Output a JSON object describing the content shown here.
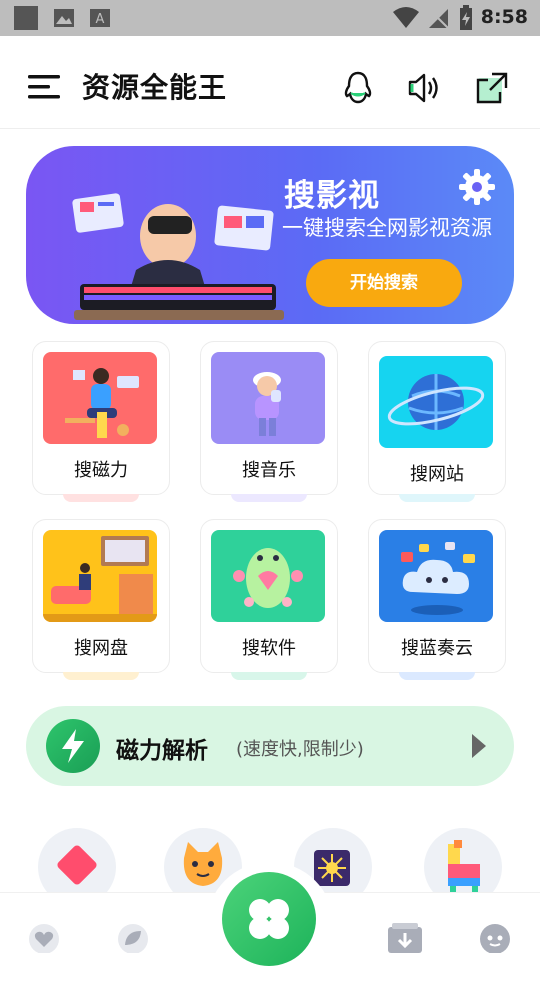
{
  "status_bar": {
    "time": "8:58"
  },
  "app": {
    "title": "资源全能王"
  },
  "banner": {
    "title": "搜影视",
    "subtitle": "一键搜索全网影视资源",
    "button_label": "开始搜索"
  },
  "grid": [
    {
      "label": "搜磁力",
      "icon": "magnet-illustration"
    },
    {
      "label": "搜音乐",
      "icon": "music-illustration"
    },
    {
      "label": "搜网站",
      "icon": "globe-illustration"
    },
    {
      "label": "搜网盘",
      "icon": "cloud-drive-illustration"
    },
    {
      "label": "搜软件",
      "icon": "software-illustration"
    },
    {
      "label": "搜蓝奏云",
      "icon": "lanzou-cloud-illustration"
    }
  ],
  "magnet_bar": {
    "title": "磁力解析",
    "subtitle": "(速度快,限制少)"
  },
  "colors": {
    "accent": "#5b6bf5",
    "button": "#f9a90f",
    "green": "#1db35a"
  }
}
